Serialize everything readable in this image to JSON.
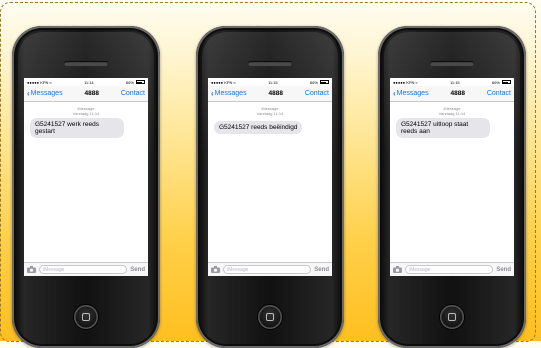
{
  "phones": [
    {
      "status": {
        "carrier": "●●●●● KPN",
        "time": "11:14",
        "battery": "66%"
      },
      "nav": {
        "back": "Messages",
        "title": "4888",
        "contact": "Contact"
      },
      "timestamp": {
        "label": "iMessage",
        "time": "Vandaag 11:14"
      },
      "message": "G5241527 werk reeds gestart",
      "input": {
        "placeholder": "iMessage",
        "send": "Send"
      }
    },
    {
      "status": {
        "carrier": "●●●●● KPN",
        "time": "11:15",
        "battery": "66%"
      },
      "nav": {
        "back": "Messages",
        "title": "4888",
        "contact": "Contact"
      },
      "timestamp": {
        "label": "iMessage",
        "time": "Vandaag 11:14"
      },
      "message": "G5241527 reeds beëindigd",
      "input": {
        "placeholder": "iMessage",
        "send": "Send"
      }
    },
    {
      "status": {
        "carrier": "●●●●● KPN",
        "time": "11:15",
        "battery": "66%"
      },
      "nav": {
        "back": "Messages",
        "title": "4888",
        "contact": "Contact"
      },
      "timestamp": {
        "label": "iMessage",
        "time": "Vandaag 11:14"
      },
      "message": "G5241527 uitloop staat reeds aan",
      "input": {
        "placeholder": "iMessage",
        "send": "Send"
      }
    }
  ],
  "colors": {
    "accent": "#1a73e8",
    "bubble": "#e5e5ea",
    "background": "#ffd04a"
  },
  "icons": [
    "chevron-left-icon",
    "camera-icon",
    "wifi-icon",
    "battery-icon",
    "home-button-icon"
  ]
}
